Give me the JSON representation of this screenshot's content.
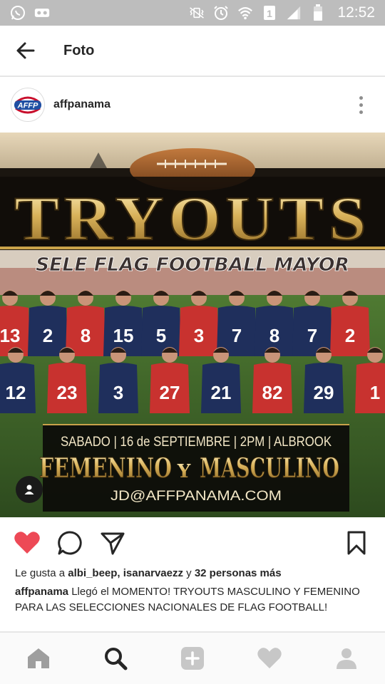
{
  "status_bar": {
    "time": "12:52",
    "icons": [
      "whatsapp-icon",
      "voicemail-icon",
      "vibrate-icon",
      "alarm-icon",
      "wifi-icon",
      "sim-1-icon",
      "signal-icon",
      "battery-icon"
    ]
  },
  "header": {
    "title": "Foto"
  },
  "post": {
    "username": "affpanama",
    "avatar_text": "AFFP",
    "image": {
      "headline": "TRYOUTS",
      "subheadline": "SELE FLAG FOOTBALL MAYOR",
      "info_line": "SABADO | 16 de SEPTIEMBRE | 2PM | ALBROOK",
      "categories_left": "FEMENINO",
      "categories_join": "Y",
      "categories_right": "MASCULINO",
      "email": "JD@AFFPANAMA.COM",
      "back_jerseys": [
        "13",
        "2",
        "8",
        "15",
        "5",
        "3",
        "7",
        "8",
        "7",
        "2"
      ],
      "front_jerseys": [
        "12",
        "23",
        "3",
        "27",
        "21",
        "82",
        "29",
        "1"
      ]
    },
    "likes": {
      "prefix": "Le gusta a ",
      "users": "albi_beep, isanarvaezz",
      "connector": " y ",
      "others": "32 personas más"
    },
    "caption": {
      "author": "affpanama",
      "text": " Llegó el MOMENTO! TRYOUTS MASCULINO Y FEMENINO PARA LAS SELECCIONES NACIONALES DE FLAG FOOTBALL!"
    }
  },
  "colors": {
    "like_red": "#ed4956",
    "status_bar_bg": "#bdbdbd",
    "nav_icon_gray": "#999999"
  },
  "bottom_nav": [
    "home-icon",
    "search-icon",
    "add-icon",
    "activity-icon",
    "profile-icon"
  ]
}
